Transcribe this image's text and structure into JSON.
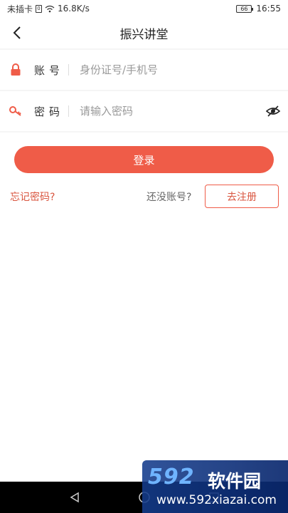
{
  "status_bar": {
    "carrier": "未插卡",
    "sim": "0",
    "speed": "16.8K/s",
    "battery": "66",
    "time": "16:55"
  },
  "header": {
    "title": "振兴讲堂",
    "back_icon": "chevron-left-icon"
  },
  "form": {
    "account": {
      "label": "账号",
      "placeholder": "身份证号/手机号",
      "value": "",
      "icon": "lock-icon"
    },
    "password": {
      "label": "密码",
      "placeholder": "请输入密码",
      "value": "",
      "icon": "key-icon",
      "toggle_icon": "eye-hidden-icon"
    }
  },
  "actions": {
    "login_label": "登录",
    "forgot_label": "忘记密码?",
    "no_account_label": "还没账号?",
    "register_label": "去注册"
  },
  "nav_bar": {
    "icons": [
      "back-triangle-icon",
      "home-circle-icon",
      "recent-square-icon"
    ]
  },
  "watermark": {
    "brand": "592",
    "brand_cn": "软件园",
    "url": "www.592xiazai.com"
  },
  "colors": {
    "accent": "#ef5c48",
    "link": "#d9553f",
    "gap": "#f5f5f5",
    "nav": "#000000"
  }
}
